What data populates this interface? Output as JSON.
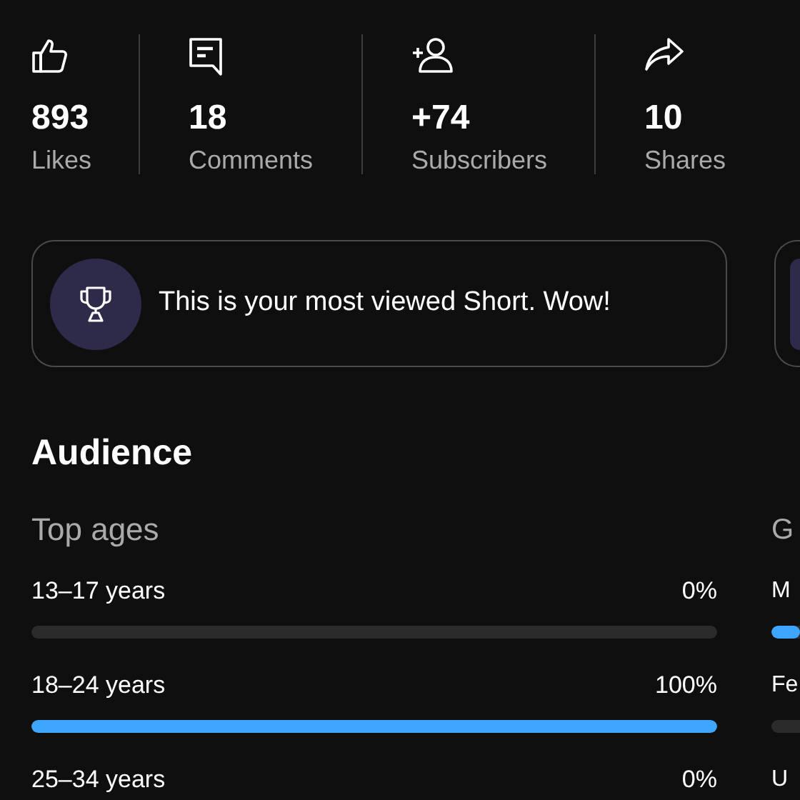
{
  "stats": [
    {
      "kind": "likes",
      "value": "893",
      "label": "Likes"
    },
    {
      "kind": "comments",
      "value": "18",
      "label": "Comments"
    },
    {
      "kind": "subscribers",
      "value": "+74",
      "label": "Subscribers"
    },
    {
      "kind": "shares",
      "value": "10",
      "label": "Shares"
    }
  ],
  "highlight_card": {
    "text": "This is your most viewed Short. Wow!"
  },
  "audience": {
    "title": "Audience",
    "top_ages": {
      "title": "Top ages",
      "rows": [
        {
          "label": "13–17 years",
          "value": "0%",
          "level": 0
        },
        {
          "label": "18–24 years",
          "value": "100%",
          "level": 1
        },
        {
          "label": "25–34 years",
          "value": "0%"
        }
      ]
    },
    "next_panel": {
      "title": "G",
      "rows": [
        {
          "label": "M",
          "level": 1
        },
        {
          "label": "Fe",
          "level": 0
        },
        {
          "label": "U"
        }
      ]
    }
  }
}
